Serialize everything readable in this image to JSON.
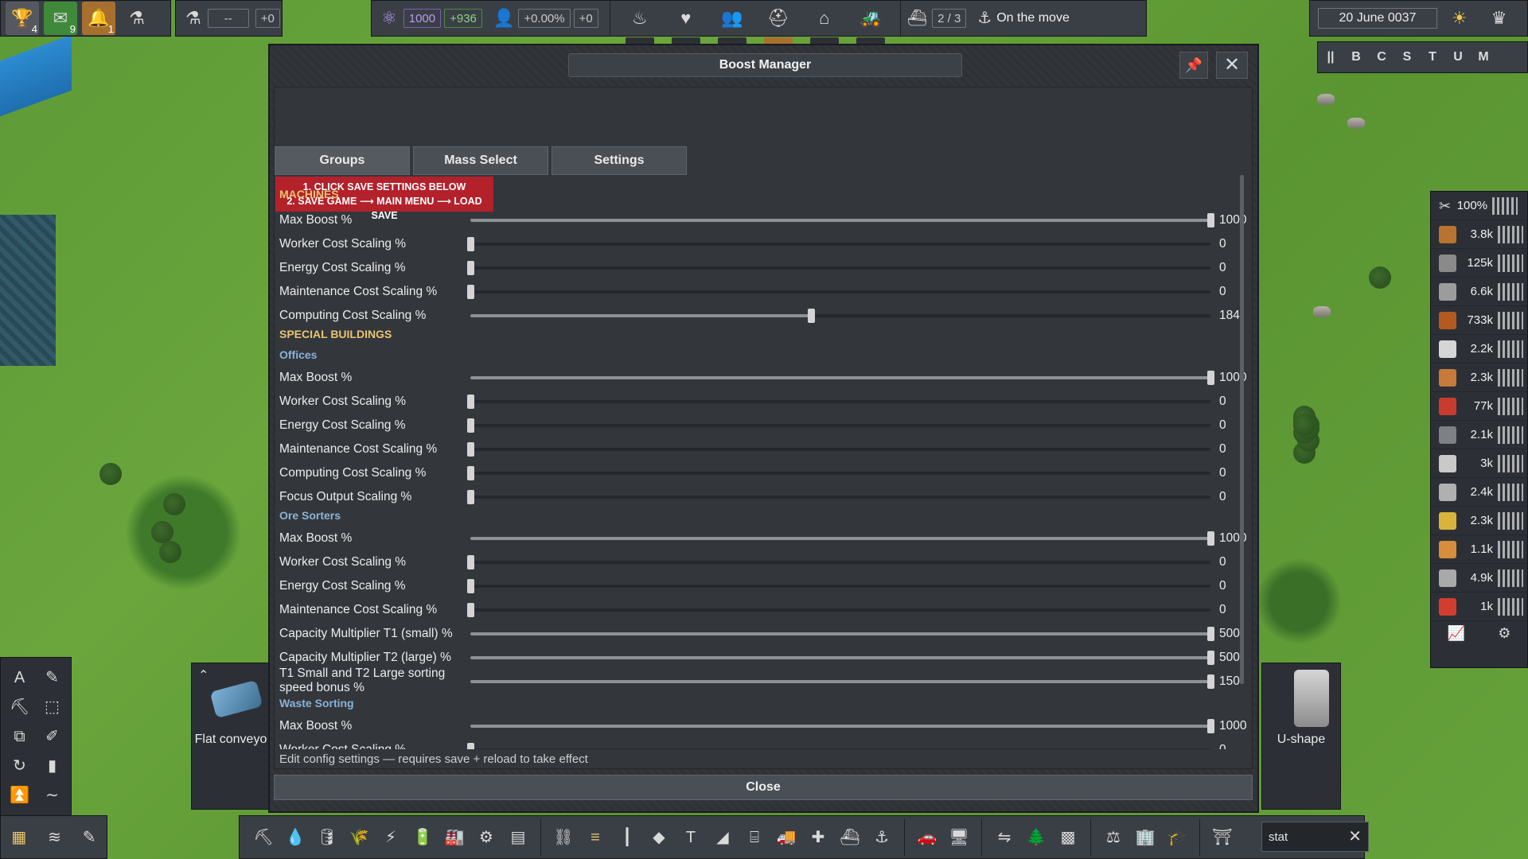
{
  "top_left": {
    "trophy_count": "4",
    "mail_count": "9",
    "alert_count": "1",
    "research_value": "--",
    "research_gain": "+0"
  },
  "top_center": {
    "unity_value": "1000",
    "unity_gain": "+936",
    "pop_growth": "+0.00%",
    "pop_gain": "+0",
    "ships": "2 / 3",
    "ship_status": "On the move"
  },
  "date": "20 June 0037",
  "speed_keys": [
    "||",
    "B",
    "C",
    "S",
    "T",
    "U",
    "M"
  ],
  "resources": {
    "header_value": "100%",
    "items": [
      {
        "icon": "wood-icon",
        "value": "3.8k",
        "color": "#b8742f"
      },
      {
        "icon": "rock-icon",
        "value": "125k",
        "color": "#8a8a8a"
      },
      {
        "icon": "iron-plate-icon",
        "value": "6.6k",
        "color": "#9c9c9c"
      },
      {
        "icon": "copper-ore-icon",
        "value": "733k",
        "color": "#b35a21"
      },
      {
        "icon": "worker-icon",
        "value": "2.2k",
        "color": "#d6d6d6"
      },
      {
        "icon": "plank-icon",
        "value": "2.3k",
        "color": "#c67b3a"
      },
      {
        "icon": "fuel-icon",
        "value": "77k",
        "color": "#c93b2f"
      },
      {
        "icon": "steel-icon",
        "value": "2.1k",
        "color": "#7d8084"
      },
      {
        "icon": "tool-icon",
        "value": "3k",
        "color": "#c9c9c9"
      },
      {
        "icon": "concrete-icon",
        "value": "2.4k",
        "color": "#b0b0b0"
      },
      {
        "icon": "gold-icon",
        "value": "2.3k",
        "color": "#d9b43a"
      },
      {
        "icon": "food-icon",
        "value": "1.1k",
        "color": "#d88d3a"
      },
      {
        "icon": "slab-icon",
        "value": "4.9k",
        "color": "#a9a9a9"
      },
      {
        "icon": "fire-icon",
        "value": "1k",
        "color": "#d23d2d"
      }
    ]
  },
  "build_left_label": "Flat conveyo",
  "build_right_label": "U-shape",
  "search_value": "stat",
  "dialog": {
    "title": "Boost Manager",
    "tabs": [
      "Groups",
      "Mass Select",
      "Settings"
    ],
    "warning_line1": "1. CLICK SAVE SETTINGS BELOW",
    "warning_line2": "2. SAVE GAME ⟶ MAIN MENU ⟶ LOAD SAVE",
    "footer_note": "Edit config settings — requires save + reload to take effect",
    "close_label": "Close",
    "scroll_position": 0.0,
    "sections": [
      {
        "kind": "section",
        "text": "MACHINES"
      },
      {
        "kind": "row",
        "label": "Max Boost %",
        "value": "1000",
        "fraction": 1.0
      },
      {
        "kind": "row",
        "label": "Worker Cost Scaling %",
        "value": "0",
        "fraction": 0.0
      },
      {
        "kind": "row",
        "label": "Energy Cost Scaling %",
        "value": "0",
        "fraction": 0.0
      },
      {
        "kind": "row",
        "label": "Maintenance Cost Scaling %",
        "value": "0",
        "fraction": 0.0
      },
      {
        "kind": "row",
        "label": "Computing Cost Scaling %",
        "value": "184",
        "fraction": 0.46
      },
      {
        "kind": "section",
        "text": "SPECIAL BUILDINGS"
      },
      {
        "kind": "subsection",
        "text": "Offices"
      },
      {
        "kind": "row",
        "label": "Max Boost %",
        "value": "1000",
        "fraction": 1.0
      },
      {
        "kind": "row",
        "label": "Worker Cost Scaling %",
        "value": "0",
        "fraction": 0.0
      },
      {
        "kind": "row",
        "label": "Energy Cost Scaling %",
        "value": "0",
        "fraction": 0.0
      },
      {
        "kind": "row",
        "label": "Maintenance Cost Scaling %",
        "value": "0",
        "fraction": 0.0
      },
      {
        "kind": "row",
        "label": "Computing Cost Scaling %",
        "value": "0",
        "fraction": 0.0
      },
      {
        "kind": "row",
        "label": "Focus Output Scaling %",
        "value": "0",
        "fraction": 0.0
      },
      {
        "kind": "subsection",
        "text": "Ore Sorters"
      },
      {
        "kind": "row",
        "label": "Max Boost %",
        "value": "1000",
        "fraction": 1.0
      },
      {
        "kind": "row",
        "label": "Worker Cost Scaling %",
        "value": "0",
        "fraction": 0.0
      },
      {
        "kind": "row",
        "label": "Energy Cost Scaling %",
        "value": "0",
        "fraction": 0.0
      },
      {
        "kind": "row",
        "label": "Maintenance Cost Scaling %",
        "value": "0",
        "fraction": 0.0
      },
      {
        "kind": "row",
        "label": "Capacity Multiplier T1 (small) %",
        "value": "500",
        "fraction": 1.0
      },
      {
        "kind": "row",
        "label": "Capacity Multiplier T2 (large) %",
        "value": "500",
        "fraction": 1.0
      },
      {
        "kind": "row2",
        "label": "T1 Small and T2 Large sorting speed bonus %",
        "value": "150",
        "fraction": 1.0
      },
      {
        "kind": "subsection",
        "text": "Waste Sorting"
      },
      {
        "kind": "row",
        "label": "Max Boost %",
        "value": "1000",
        "fraction": 1.0
      },
      {
        "kind": "row",
        "label": "Worker Cost Scaling %",
        "value": "0",
        "fraction": 0.0
      }
    ]
  }
}
